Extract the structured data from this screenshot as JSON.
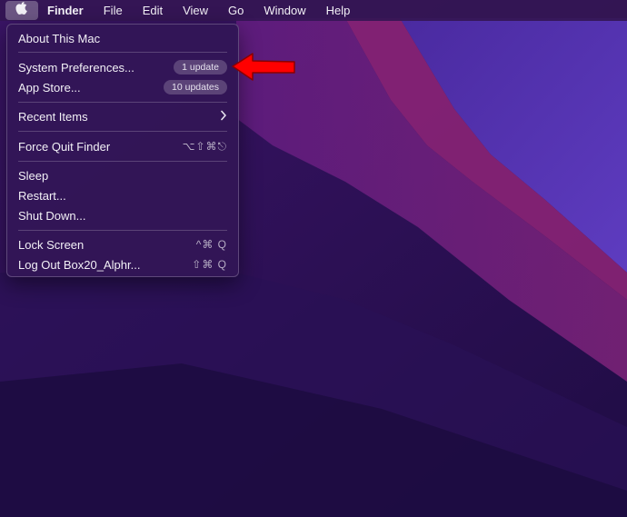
{
  "menubar": {
    "apple_icon": "apple-logo-icon",
    "items": [
      "Finder",
      "File",
      "Edit",
      "View",
      "Go",
      "Window",
      "Help"
    ]
  },
  "apple_menu": {
    "about": "About This Mac",
    "system_prefs": {
      "label": "System Preferences...",
      "badge": "1 update"
    },
    "app_store": {
      "label": "App Store...",
      "badge": "10 updates"
    },
    "recent_items": {
      "label": "Recent Items",
      "icon": "chevron-right-icon"
    },
    "force_quit": {
      "label": "Force Quit Finder",
      "shortcut": "⌥⇧⌘⎋"
    },
    "sleep": "Sleep",
    "restart": "Restart...",
    "shut_down": "Shut Down...",
    "lock_screen": {
      "label": "Lock Screen",
      "shortcut": "^⌘ Q"
    },
    "log_out": {
      "label": "Log Out Box20_Alphr...",
      "shortcut": "⇧⌘ Q"
    }
  },
  "annotation": {
    "icon": "red-arrow-icon",
    "color": "#ff0000"
  },
  "colors": {
    "menubar_bg": "#341654",
    "menu_bg": "#321656",
    "wallpaper_dark": "#26104e",
    "wallpaper_mid": "#5a1a7a",
    "wallpaper_accent": "#a0287c"
  }
}
